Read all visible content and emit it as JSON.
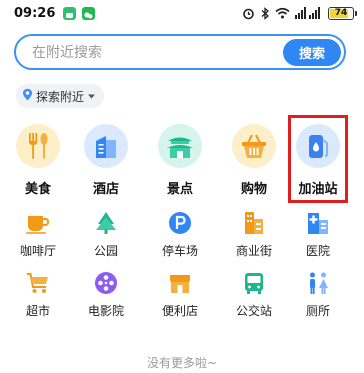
{
  "status_bar": {
    "time": "09:26",
    "battery": "74",
    "battery_level": 0.74,
    "icons": [
      "chat-app-icon",
      "wechat-icon",
      "alarm-icon",
      "bluetooth-icon",
      "wifi-icon",
      "signal-icon",
      "battery-icon"
    ]
  },
  "search": {
    "placeholder": "在附近搜索",
    "button_label": "搜索"
  },
  "location_chip": {
    "label": "探索附近",
    "icon": "location-pin-icon",
    "caret": "chevron-down-icon"
  },
  "featured_categories": [
    {
      "label": "美食",
      "icon": "fork-spoon-icon"
    },
    {
      "label": "酒店",
      "icon": "hotel-building-icon"
    },
    {
      "label": "景点",
      "icon": "pavilion-icon"
    },
    {
      "label": "购物",
      "icon": "shopping-basket-icon"
    },
    {
      "label": "加油站",
      "icon": "fuel-pump-icon"
    }
  ],
  "categories": [
    {
      "label": "咖啡厅",
      "icon": "coffee-cup-icon"
    },
    {
      "label": "公园",
      "icon": "tree-icon"
    },
    {
      "label": "停车场",
      "icon": "parking-icon"
    },
    {
      "label": "商业街",
      "icon": "shop-street-icon"
    },
    {
      "label": "医院",
      "icon": "hospital-icon"
    },
    {
      "label": "超市",
      "icon": "shopping-cart-icon"
    },
    {
      "label": "电影院",
      "icon": "film-reel-icon"
    },
    {
      "label": "便利店",
      "icon": "store-icon"
    },
    {
      "label": "公交站",
      "icon": "bus-icon"
    },
    {
      "label": "厕所",
      "icon": "toilet-icon"
    }
  ],
  "footer": {
    "text": "没有更多啦~"
  },
  "colors": {
    "accent": "#2f87f4",
    "highlight": "#e21d1d"
  }
}
